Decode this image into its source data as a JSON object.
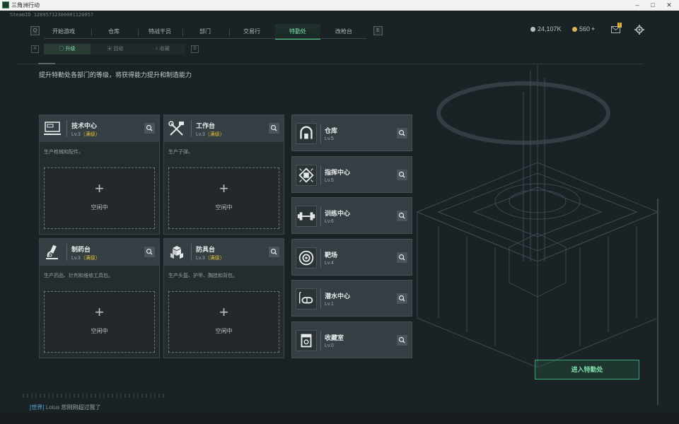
{
  "window": {
    "title": "三角洲行动"
  },
  "uid_text": "SteamID 12895712300001120057",
  "topnav": {
    "hint_left": "Q",
    "hint_right": "E",
    "tabs": [
      {
        "label": "开始游戏"
      },
      {
        "label": "仓库"
      },
      {
        "label": "特战干员"
      },
      {
        "label": "部门"
      },
      {
        "label": "交易行"
      },
      {
        "label": "特勤处",
        "active": true
      },
      {
        "label": "改枪台"
      }
    ]
  },
  "currency": {
    "primary": "24,107K",
    "secondary": "560",
    "plus": "+",
    "primary_color": "#b8c0c4",
    "secondary_color": "#d8b45a"
  },
  "header_icons": {
    "mail": "mail-icon",
    "settings": "gear-icon",
    "mail_badge": "!"
  },
  "subnav": {
    "hint_left": "A",
    "hint_right": "D",
    "tabs": [
      {
        "label": "升级",
        "active": true
      },
      {
        "label": "回收"
      },
      {
        "label": "收藏"
      }
    ]
  },
  "description": "提升特勤处各部门的等级，将获得能力提升和制造能力",
  "workshops": [
    {
      "name": "技术中心",
      "level": "Lv.3",
      "max": "（满级）",
      "desc": "生产枪械和配件。",
      "slot_plus": "+",
      "slot_label": "空闲中",
      "icon": "computer-icon"
    },
    {
      "name": "工作台",
      "level": "Lv.3",
      "max": "（满级）",
      "desc": "生产子弹。",
      "slot_plus": "+",
      "slot_label": "空闲中",
      "icon": "tools-icon"
    },
    {
      "name": "制药台",
      "level": "Lv.3",
      "max": "（满级）",
      "desc": "生产药品、针剂和维修工具包。",
      "slot_plus": "+",
      "slot_label": "空闲中",
      "icon": "microscope-icon"
    },
    {
      "name": "防具台",
      "level": "Lv.3",
      "max": "（满级）",
      "desc": "生产头盔、护甲、胸挂和背包。",
      "slot_plus": "+",
      "slot_label": "空闲中",
      "icon": "armor-icon"
    }
  ],
  "facilities": [
    {
      "name": "仓库",
      "level": "Lv.5",
      "icon": "warehouse-icon"
    },
    {
      "name": "指挥中心",
      "level": "Lv.5",
      "icon": "chip-icon"
    },
    {
      "name": "训练中心",
      "level": "Lv.6",
      "icon": "dumbbell-icon"
    },
    {
      "name": "靶场",
      "level": "Lv.4",
      "icon": "target-icon"
    },
    {
      "name": "潜水中心",
      "level": "Lv.1",
      "icon": "diving-icon"
    },
    {
      "name": "收藏室",
      "level": "Lv.0",
      "icon": "trophy-icon"
    }
  ],
  "enter_button": "进入特勤处",
  "chat": {
    "channel": "[世界]",
    "name": "Lotus",
    "text": "您刚刚超过我了"
  }
}
